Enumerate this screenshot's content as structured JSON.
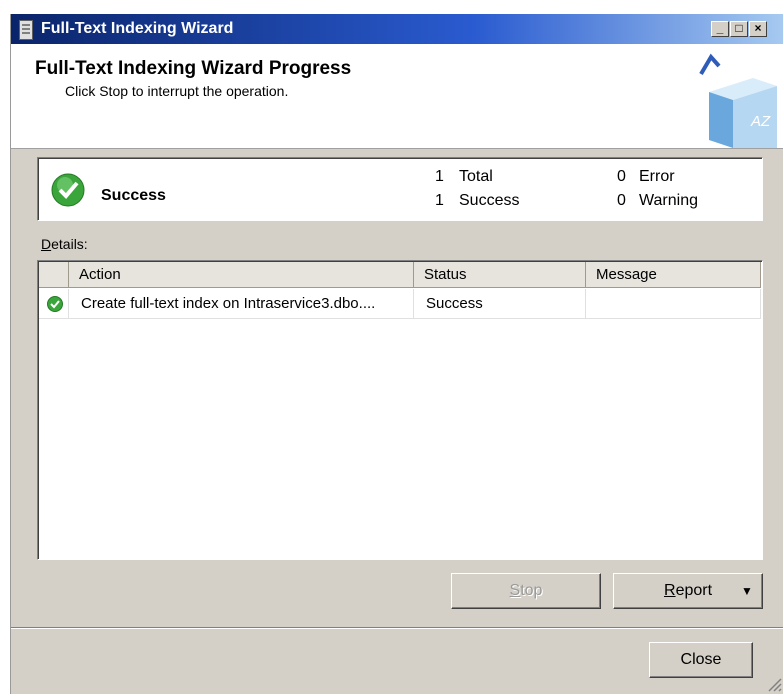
{
  "window": {
    "title": "Full-Text Indexing Wizard",
    "controls": {
      "minimize": "_",
      "maximize": "□",
      "close": "×"
    }
  },
  "header": {
    "title": "Full-Text Indexing Wizard Progress",
    "subtitle": "Click Stop to interrupt the operation.",
    "book_label": "AZ"
  },
  "status": {
    "text": "Success",
    "total_count": "1",
    "total_label": "Total",
    "success_count": "1",
    "success_label": "Success",
    "error_count": "0",
    "error_label": "Error",
    "warning_count": "0",
    "warning_label": "Warning"
  },
  "details": {
    "label_prefix": "D",
    "label_rest": "etails:",
    "columns": [
      "Action",
      "Status",
      "Message"
    ],
    "rows": [
      {
        "action": "Create full-text index on Intraservice3.dbo....",
        "status": "Success",
        "message": ""
      }
    ]
  },
  "buttons": {
    "stop_prefix": "S",
    "stop_rest": "top",
    "report_prefix": "R",
    "report_rest": "eport",
    "close": "Close"
  },
  "colors": {
    "accent": "#0a246a",
    "success": "#3aa53a",
    "face": "#d4d0c8"
  }
}
